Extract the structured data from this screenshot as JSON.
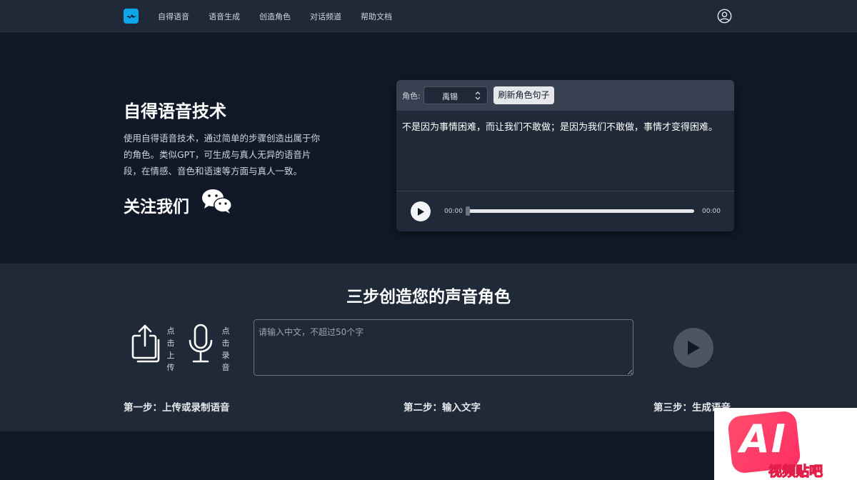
{
  "nav": {
    "items": [
      "自得语音",
      "语音生成",
      "创造角色",
      "对话频道",
      "帮助文档"
    ]
  },
  "hero": {
    "title": "自得语音技术",
    "description": "使用自得语音技术，通过简单的步骤创造出属于你的角色。类似GPT，可生成与真人无异的语音片段，在情感、音色和语速等方面与真人一致。",
    "follow_label": "关注我们"
  },
  "player": {
    "role_label": "角色:",
    "role_value": "禹锡",
    "refresh_label": "刷新角色句子",
    "sentence": "不是因为事情困难，而让我们不敢做；是因为我们不敢做，事情才变得困难。",
    "current_time": "00:00",
    "duration": "00:00",
    "progress": 0
  },
  "steps": {
    "title": "三步创造您的声音角色",
    "upload_label": "点击上传",
    "record_label": "点击录音",
    "input_placeholder": "请输入中文，不超过50个字",
    "step1": "第一步：上传或录制语音",
    "step2": "第二步：输入文字",
    "step3": "第三步：生成语音"
  },
  "watermark": {
    "main": "AI",
    "sub": "视频贴吧"
  },
  "colors": {
    "background": "#111827",
    "panel": "#1f2937",
    "accent": "#0ea5e9",
    "watermark": "#ff2e63"
  }
}
